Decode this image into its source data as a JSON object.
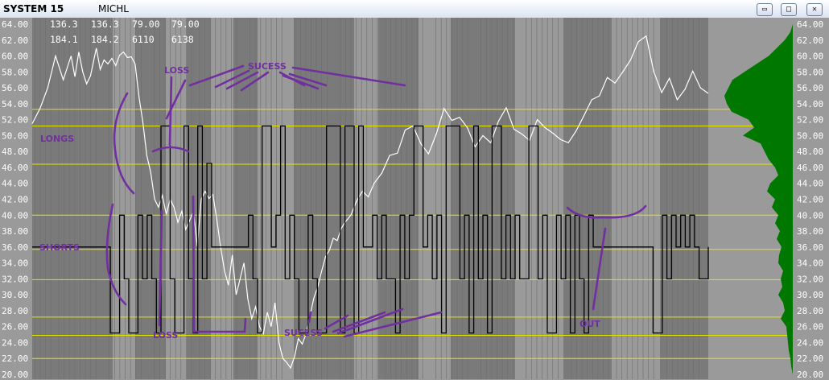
{
  "window": {
    "title": "SYSTEM 15",
    "symbol": "MICHL",
    "buttons": {
      "minimize": "▭",
      "maximize": "□",
      "close": "✕"
    }
  },
  "readouts": {
    "row1": [
      "136.3",
      "136.3",
      "79.00",
      "79.00"
    ],
    "row2": [
      "184.1",
      "184.2",
      "6110",
      "6138"
    ]
  },
  "chart_data": {
    "type": "line",
    "ylim": [
      20,
      64
    ],
    "y_ticks": [
      "64.00",
      "62.00",
      "60.00",
      "58.00",
      "56.00",
      "54.00",
      "52.00",
      "50.00",
      "48.00",
      "46.00",
      "44.00",
      "42.00",
      "40.00",
      "38.00",
      "36.00",
      "34.00",
      "32.00",
      "30.00",
      "28.00",
      "26.00",
      "24.00",
      "22.00",
      "20.00"
    ],
    "grid_levels": [
      53.3,
      51.2,
      46.4,
      40,
      35.7,
      31.9,
      27.2,
      24.9,
      22
    ],
    "series": [
      {
        "role": "price",
        "color": "#ffffff",
        "x": [
          0,
          4,
          8,
          12,
          16,
          20,
          22,
          24,
          26,
          28,
          30,
          33,
          35,
          37,
          39,
          41,
          43,
          45,
          47,
          49,
          51,
          53,
          55,
          57,
          59,
          61,
          63,
          65,
          67,
          69,
          71,
          73,
          75,
          77,
          79,
          81,
          83,
          85,
          87,
          89,
          91,
          93,
          95,
          97,
          99,
          101,
          103,
          105,
          107,
          109,
          111,
          113,
          115,
          117,
          119,
          121,
          123,
          125,
          127,
          129,
          131,
          133,
          135,
          137,
          139,
          141,
          143,
          145,
          147,
          149,
          151,
          153,
          155,
          157,
          159,
          161,
          164,
          167,
          170,
          173,
          176,
          180,
          184,
          188,
          192,
          196,
          200,
          204,
          208,
          212,
          216,
          220,
          224,
          228,
          232,
          236,
          240,
          244,
          248,
          252,
          256,
          260,
          264,
          268,
          272,
          276,
          280,
          284,
          288,
          292,
          296,
          300,
          304,
          308,
          312,
          316,
          320,
          324,
          328,
          332,
          336,
          340,
          344,
          348
        ],
        "y": [
          51.5,
          53.4,
          56.0,
          60.0,
          57.0,
          60.0,
          57.4,
          60.5,
          58.0,
          56.5,
          57.5,
          61.0,
          58.3,
          59.5,
          59.0,
          59.7,
          58.8,
          60.1,
          60.5,
          59.8,
          59.9,
          59.0,
          54.8,
          51.6,
          47.5,
          45.4,
          42.0,
          41.0,
          42.5,
          40.1,
          42.0,
          41.0,
          39.1,
          40.5,
          38.2,
          39.3,
          40.5,
          36.1,
          42.0,
          43.0,
          42.1,
          42.6,
          39.5,
          36.0,
          33.0,
          31.2,
          35.0,
          30.0,
          32.0,
          34.0,
          29.5,
          27.0,
          28.5,
          26.0,
          25.1,
          27.8,
          26.0,
          29.0,
          24.0,
          22.0,
          21.5,
          20.8,
          22.2,
          24.5,
          23.8,
          25.1,
          27.4,
          29.6,
          31.0,
          33.0,
          34.8,
          35.6,
          37.1,
          36.8,
          38.3,
          39.1,
          40.0,
          41.8,
          43.0,
          42.3,
          44.0,
          45.3,
          47.5,
          47.8,
          50.7,
          51.2,
          49.0,
          47.7,
          50.2,
          53.4,
          51.9,
          52.3,
          51.0,
          48.6,
          50.0,
          49.1,
          51.8,
          53.5,
          50.8,
          50.2,
          49.4,
          52.0,
          51.0,
          50.3,
          49.5,
          49.1,
          50.6,
          52.5,
          54.5,
          55.0,
          57.3,
          56.6,
          58.0,
          59.5,
          61.8,
          62.5,
          58.0,
          55.4,
          57.2,
          54.5,
          55.8,
          58.1,
          56.0,
          55.3
        ]
      },
      {
        "role": "position",
        "color": "#000000",
        "steps": [
          [
            0,
            36
          ],
          [
            17,
            36
          ],
          [
            17,
            25.2
          ],
          [
            19,
            25.2
          ],
          [
            19,
            40
          ],
          [
            20,
            40
          ],
          [
            20,
            32
          ],
          [
            21,
            32
          ],
          [
            21,
            25.2
          ],
          [
            23,
            25.2
          ],
          [
            23,
            40
          ],
          [
            24,
            40
          ],
          [
            24,
            32
          ],
          [
            25,
            32
          ],
          [
            25,
            40
          ],
          [
            26,
            40
          ],
          [
            26,
            32
          ],
          [
            27,
            32
          ],
          [
            27,
            25.2
          ],
          [
            28,
            25.2
          ],
          [
            28,
            51.2
          ],
          [
            30,
            51.2
          ],
          [
            30,
            32
          ],
          [
            31,
            32
          ],
          [
            31,
            25.2
          ],
          [
            33,
            25.2
          ],
          [
            33,
            51.2
          ],
          [
            34,
            51.2
          ],
          [
            34,
            32
          ],
          [
            35,
            32
          ],
          [
            35,
            25.2
          ],
          [
            36,
            25.2
          ],
          [
            36,
            51.2
          ],
          [
            37,
            51.2
          ],
          [
            37,
            32
          ],
          [
            38,
            32
          ],
          [
            38,
            46.5
          ],
          [
            39,
            46.5
          ],
          [
            39,
            36
          ],
          [
            47,
            36
          ],
          [
            47,
            40
          ],
          [
            48,
            40
          ],
          [
            48,
            32
          ],
          [
            49,
            32
          ],
          [
            49,
            25.2
          ],
          [
            50,
            25.2
          ],
          [
            50,
            51.2
          ],
          [
            52,
            51.2
          ],
          [
            52,
            36
          ],
          [
            53,
            36
          ],
          [
            53,
            40
          ],
          [
            54,
            40
          ],
          [
            54,
            51.2
          ],
          [
            55,
            51.2
          ],
          [
            55,
            32
          ],
          [
            56,
            32
          ],
          [
            56,
            40
          ],
          [
            57,
            40
          ],
          [
            57,
            32
          ],
          [
            58,
            32
          ],
          [
            58,
            25.2
          ],
          [
            60,
            25.2
          ],
          [
            60,
            40
          ],
          [
            61,
            40
          ],
          [
            61,
            32
          ],
          [
            62,
            32
          ],
          [
            62,
            25.2
          ],
          [
            64,
            25.2
          ],
          [
            64,
            51.2
          ],
          [
            67,
            51.2
          ],
          [
            67,
            25.2
          ],
          [
            68,
            25.2
          ],
          [
            68,
            51.2
          ],
          [
            70,
            51.2
          ],
          [
            70,
            25.2
          ],
          [
            71,
            25.2
          ],
          [
            71,
            51.2
          ],
          [
            72,
            51.2
          ],
          [
            72,
            36
          ],
          [
            74,
            36
          ],
          [
            74,
            40
          ],
          [
            75,
            40
          ],
          [
            75,
            32
          ],
          [
            76,
            32
          ],
          [
            76,
            40
          ],
          [
            77,
            40
          ],
          [
            77,
            32
          ],
          [
            79,
            32
          ],
          [
            79,
            25.2
          ],
          [
            80,
            25.2
          ],
          [
            80,
            40
          ],
          [
            81,
            40
          ],
          [
            81,
            32
          ],
          [
            82,
            32
          ],
          [
            82,
            40
          ],
          [
            83,
            40
          ],
          [
            83,
            51.2
          ],
          [
            85,
            51.2
          ],
          [
            85,
            36
          ],
          [
            86,
            36
          ],
          [
            86,
            40
          ],
          [
            87,
            40
          ],
          [
            87,
            32
          ],
          [
            88,
            32
          ],
          [
            88,
            40
          ],
          [
            89,
            40
          ],
          [
            89,
            25.2
          ],
          [
            90,
            25.2
          ],
          [
            90,
            51.2
          ],
          [
            93,
            51.2
          ],
          [
            93,
            32
          ],
          [
            94,
            32
          ],
          [
            94,
            40
          ],
          [
            95,
            40
          ],
          [
            95,
            25.2
          ],
          [
            96,
            25.2
          ],
          [
            96,
            51.2
          ],
          [
            97,
            51.2
          ],
          [
            97,
            32
          ],
          [
            98,
            32
          ],
          [
            98,
            40
          ],
          [
            99,
            40
          ],
          [
            99,
            25.2
          ],
          [
            100,
            25.2
          ],
          [
            100,
            51.2
          ],
          [
            102,
            51.2
          ],
          [
            102,
            32
          ],
          [
            103,
            32
          ],
          [
            103,
            40
          ],
          [
            104,
            40
          ],
          [
            104,
            32
          ],
          [
            105,
            32
          ],
          [
            105,
            40
          ],
          [
            106,
            40
          ],
          [
            106,
            32
          ],
          [
            108,
            32
          ],
          [
            108,
            51.2
          ],
          [
            110,
            51.2
          ],
          [
            110,
            32
          ],
          [
            111,
            32
          ],
          [
            111,
            40
          ],
          [
            112,
            40
          ],
          [
            112,
            25.2
          ],
          [
            114,
            25.2
          ],
          [
            114,
            40
          ],
          [
            115,
            40
          ],
          [
            115,
            32
          ],
          [
            116,
            32
          ],
          [
            116,
            40
          ],
          [
            117,
            40
          ],
          [
            117,
            25.2
          ],
          [
            118,
            25.2
          ],
          [
            118,
            40
          ],
          [
            119,
            40
          ],
          [
            119,
            32
          ],
          [
            120,
            32
          ],
          [
            120,
            25.2
          ],
          [
            121,
            25.2
          ],
          [
            121,
            40
          ],
          [
            122,
            40
          ],
          [
            122,
            36
          ],
          [
            135,
            36
          ],
          [
            135,
            25.2
          ],
          [
            137,
            25.2
          ],
          [
            137,
            40
          ],
          [
            138,
            40
          ],
          [
            138,
            32
          ],
          [
            139,
            32
          ],
          [
            139,
            40
          ],
          [
            140,
            40
          ],
          [
            140,
            36
          ],
          [
            141,
            36
          ],
          [
            141,
            40
          ],
          [
            142,
            40
          ],
          [
            142,
            36
          ],
          [
            143,
            36
          ],
          [
            143,
            40
          ],
          [
            144,
            40
          ],
          [
            144,
            36
          ],
          [
            145,
            36
          ],
          [
            145,
            32
          ],
          [
            147,
            32
          ],
          [
            147,
            36
          ]
        ]
      }
    ],
    "profile": {
      "color": "#007800",
      "levels": [
        64,
        63,
        62,
        61,
        60,
        59,
        58,
        57,
        56,
        55,
        54,
        53,
        52,
        51,
        50,
        49,
        48,
        47,
        46,
        45,
        44,
        43,
        42,
        41,
        40,
        39,
        38,
        37,
        36,
        35,
        34,
        33,
        32,
        31,
        30,
        29,
        28,
        27,
        26,
        25,
        24,
        23,
        22,
        21,
        20
      ],
      "widths": [
        0,
        3,
        10,
        20,
        30,
        45,
        60,
        75,
        80,
        85,
        82,
        76,
        55,
        48,
        62,
        40,
        35,
        30,
        22,
        18,
        28,
        32,
        22,
        26,
        18,
        22,
        16,
        20,
        14,
        17,
        18,
        12,
        15,
        13,
        18,
        12,
        10,
        15,
        8,
        7,
        6,
        5,
        3,
        2,
        0
      ]
    },
    "annotations": [
      "LOSS",
      "SUCESS",
      "LONGS",
      "SHORTS",
      "LOSS",
      "SUCESS",
      "OUT"
    ]
  },
  "colors": {
    "background": "#9a9a9a",
    "band_dark": "#7a7a7a",
    "grid": "#e4e400",
    "annotation": "#7030a0",
    "profile": "#007800"
  }
}
